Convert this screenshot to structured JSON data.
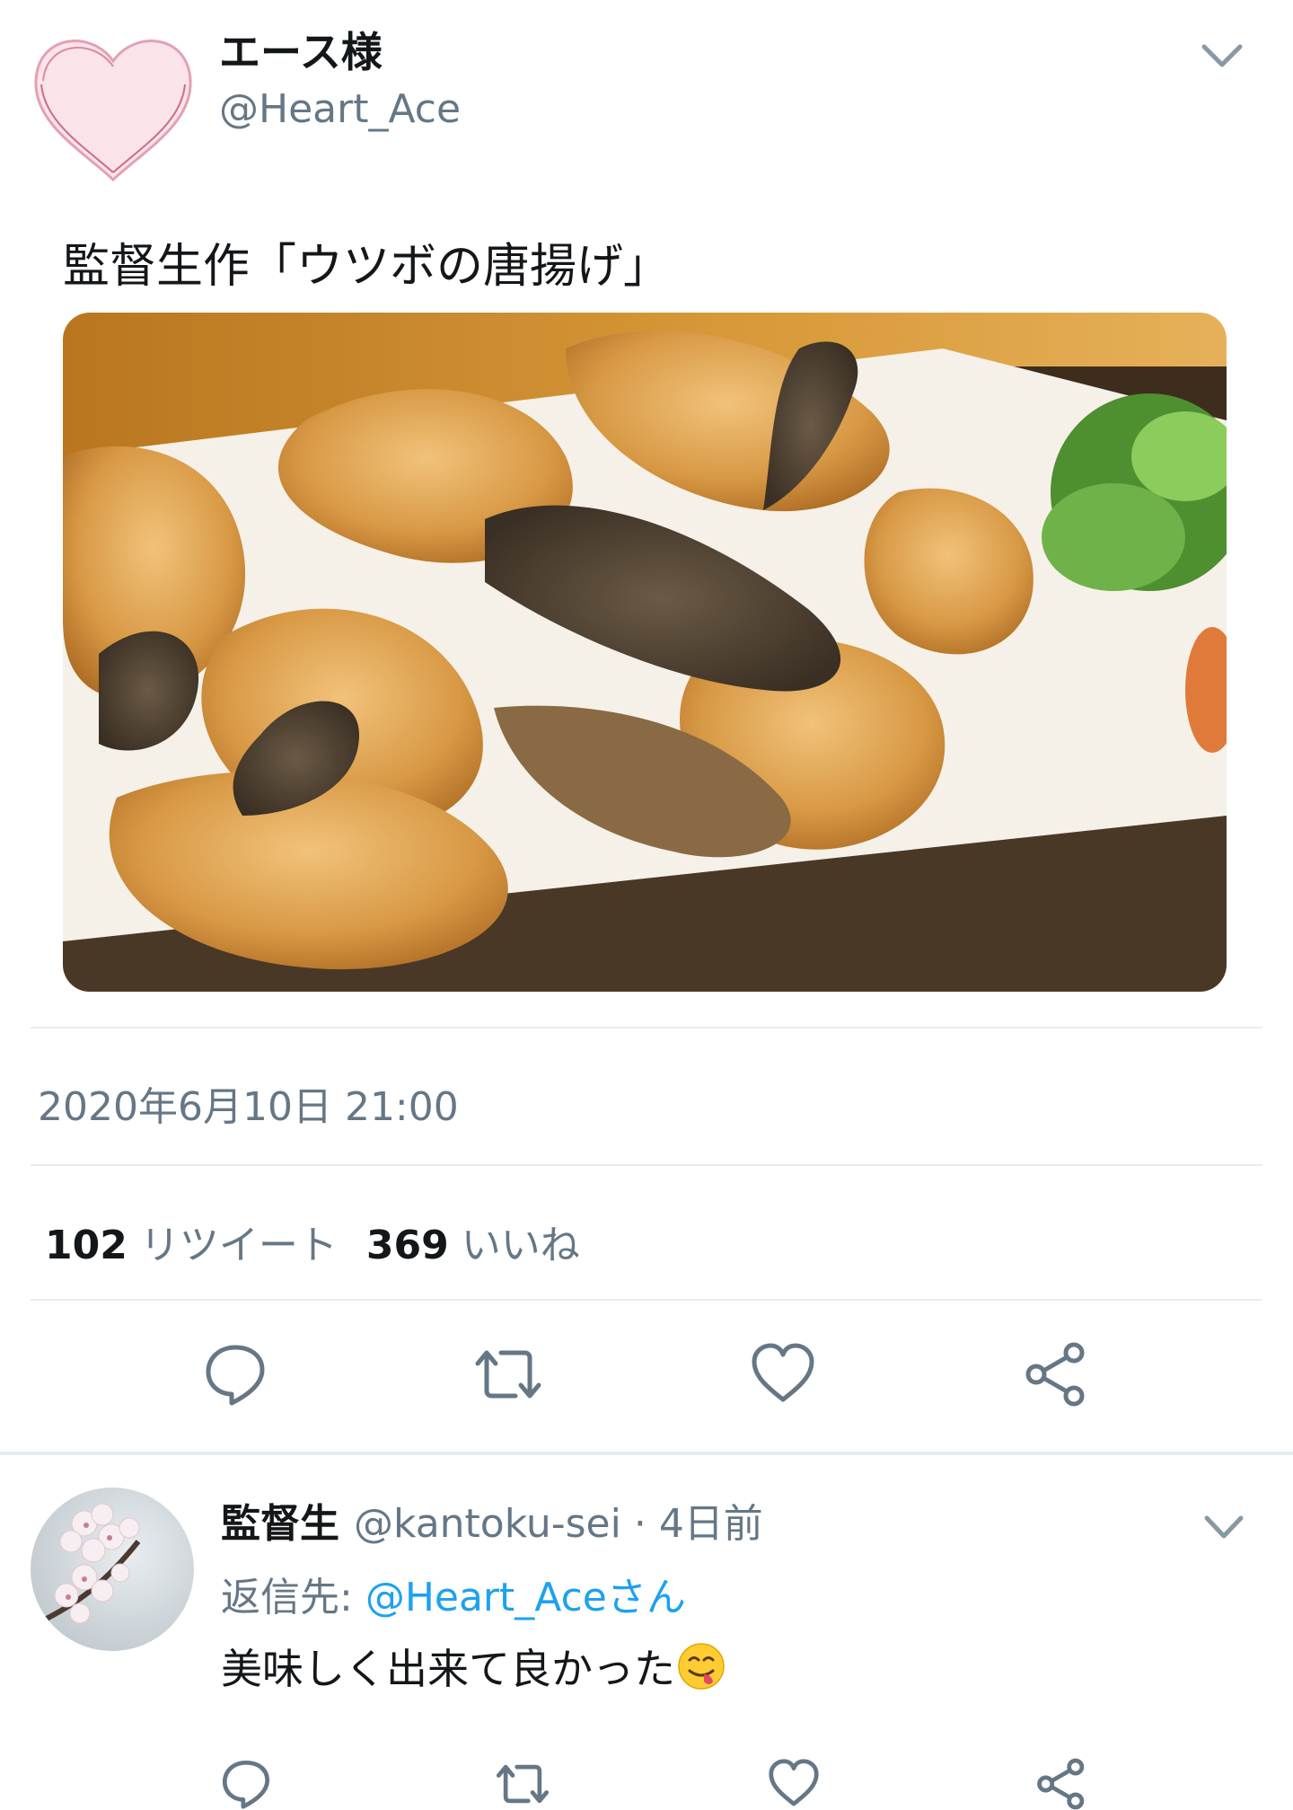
{
  "tweet": {
    "author_name": "エース様",
    "author_handle": "@Heart_Ace",
    "text": "監督生作「ウツボの唐揚げ」",
    "image_alt_icon": "fried-moray-eel-photo",
    "timestamp": "2020年6月10日 21:00",
    "retweet_count": "102",
    "retweet_label": "リツイート",
    "like_count": "369",
    "like_label": "いいね"
  },
  "reply": {
    "author_name": "監督生",
    "author_handle": "@kantoku-sei",
    "time": "· 4日前",
    "reply_to_prefix": "返信先: ",
    "reply_to_mention": "@Heart_Aceさん",
    "text": "美味しく出来て良かった",
    "emoji_icon": "yum-face-emoji"
  },
  "icons": {
    "reply": "speech-bubble-icon",
    "retweet": "retweet-arrows-icon",
    "like": "heart-icon",
    "share": "share-icon",
    "menu": "chevron-down-icon"
  },
  "colors": {
    "text_primary": "#14171a",
    "text_secondary": "#657786",
    "link": "#1da1f2",
    "divider": "#e6ecf0"
  }
}
